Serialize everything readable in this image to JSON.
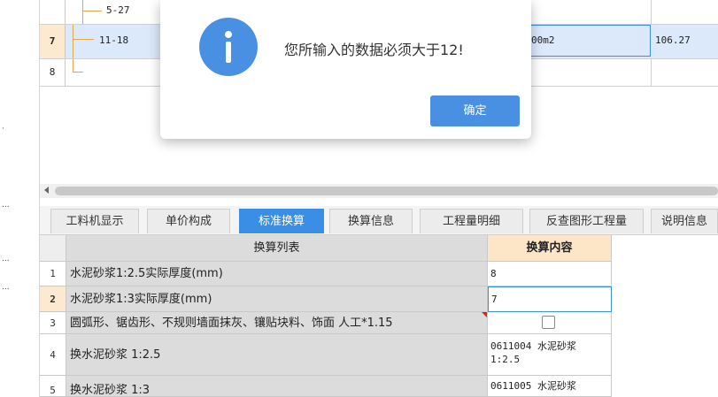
{
  "left_panel": {
    "marks": [
      "·",
      "...",
      "...",
      "..."
    ]
  },
  "top_grid": {
    "rows": [
      {
        "num": "",
        "code": "5-27",
        "unit": "",
        "value": ""
      },
      {
        "num": "7",
        "code": "11-18",
        "unit": "00m2",
        "value": "106.27",
        "selected": true
      },
      {
        "num": "8",
        "code": "",
        "unit": "",
        "value": ""
      }
    ]
  },
  "tabs": [
    "工料机显示",
    "单价构成",
    "标准换算",
    "换算信息",
    "工程量明细",
    "反查图形工程量",
    "说明信息"
  ],
  "active_tab_index": 2,
  "bottom_grid": {
    "headers": {
      "list": "换算列表",
      "content": "换算内容"
    },
    "rows": [
      {
        "num": "1",
        "name": "水泥砂浆1:2.5实际厚度(mm)",
        "content": "8"
      },
      {
        "num": "2",
        "name": "水泥砂浆1:3实际厚度(mm)",
        "content": "7",
        "selected": true
      },
      {
        "num": "3",
        "name": "圆弧形、锯齿形、不规则墙面抹灰、镶贴块料、饰面 人工*1.15",
        "content": "",
        "checkbox": true,
        "checked": false
      },
      {
        "num": "4",
        "name": "换水泥砂浆 1:2.5",
        "content_line1": "0611004  水泥砂浆",
        "content_line2": "1:2.5"
      },
      {
        "num": "5",
        "name": "换水泥砂浆 1:3",
        "content_line1": "0611005  水泥砂浆"
      }
    ]
  },
  "dialog": {
    "icon": "info-icon",
    "message": "您所输入的数据必须大于12!",
    "ok_label": "确定"
  },
  "colors": {
    "accent": "#4a90e2",
    "selected_row": "#dce9fb",
    "header_content": "#fde6c7"
  }
}
